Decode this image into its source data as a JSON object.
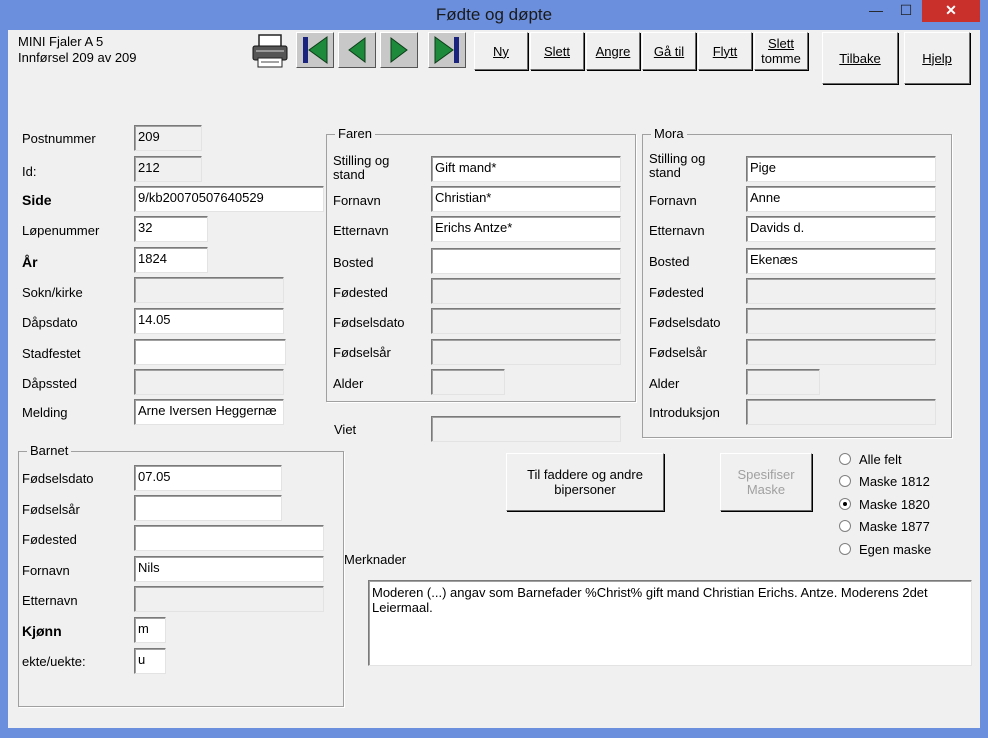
{
  "window": {
    "title": "Fødte og døpte",
    "minimize": "—",
    "maximize": "☐",
    "close": "✕"
  },
  "info": {
    "line1": "MINI Fjaler  A 5",
    "line2": "Innførsel 209 av 209"
  },
  "toolbar": {
    "new": "Ny",
    "delete": "Slett",
    "undo": "Angre",
    "goto": "Gå til",
    "move": "Flytt",
    "delete_empty_1": "Slett",
    "delete_empty_2": "tomme",
    "back": "Tilbake",
    "help": "Hjelp"
  },
  "left": {
    "postnummer_label": "Postnummer",
    "postnummer": "209",
    "id_label": "Id:",
    "id": "212",
    "side_label": "Side",
    "side": "9/kb20070507640529",
    "lopenummer_label": "Løpenummer",
    "lopenummer": "32",
    "ar_label": "År",
    "ar": "1824",
    "sokn_label": "Sokn/kirke",
    "sokn": "",
    "dapsdato_label": "Dåpsdato",
    "dapsdato": "14.05",
    "stadfestet_label": "Stadfestet",
    "stadfestet": "",
    "dapssted_label": "Dåpssted",
    "dapssted": "",
    "melding_label": "Melding",
    "melding": "Arne Iversen Heggernæ"
  },
  "barnet": {
    "legend": "Barnet",
    "fodselsdato_label": "Fødselsdato",
    "fodselsdato": "07.05",
    "fodselsar_label": "Fødselsår",
    "fodselsar": "",
    "fodested_label": "Fødested",
    "fodested": "",
    "fornavn_label": "Fornavn",
    "fornavn": "Nils",
    "etternavn_label": "Etternavn",
    "etternavn": "",
    "kjonn_label": "Kjønn",
    "kjonn": "m",
    "ekte_label": "ekte/uekte:",
    "ekte": "u"
  },
  "faren": {
    "legend": "Faren",
    "stilling_label_1": "Stilling og",
    "stilling_label_2": "stand",
    "stilling": "Gift mand*",
    "fornavn_label": "Fornavn",
    "fornavn": "Christian*",
    "etternavn_label": "Etternavn",
    "etternavn": "Erichs Antze*",
    "bosted_label": "Bosted",
    "bosted": "",
    "fodested_label": "Fødested",
    "fodested": "",
    "fodselsdato_label": "Fødselsdato",
    "fodselsdato": "",
    "fodselsar_label": "Fødselsår",
    "fodselsar": "",
    "alder_label": "Alder",
    "alder": ""
  },
  "viet": {
    "label": "Viet",
    "value": ""
  },
  "mora": {
    "legend": "Mora",
    "stilling_label_1": "Stilling og",
    "stilling_label_2": "stand",
    "stilling": "Pige",
    "fornavn_label": "Fornavn",
    "fornavn": "Anne",
    "etternavn_label": "Etternavn",
    "etternavn": "Davids d.",
    "bosted_label": "Bosted",
    "bosted": "Ekenæs",
    "fodested_label": "Fødested",
    "fodested": "",
    "fodselsdato_label": "Fødselsdato",
    "fodselsdato": "",
    "fodselsar_label": "Fødselsår",
    "fodselsar": "",
    "alder_label": "Alder",
    "alder": "",
    "introduksjon_label": "Introduksjon",
    "introduksjon": ""
  },
  "actions": {
    "faddere_1": "Til faddere og andre",
    "faddere_2": "bipersoner",
    "spesifiser_1": "Spesifiser",
    "spesifiser_2": "Maske"
  },
  "mask_options": [
    {
      "label": "Alle felt",
      "selected": false
    },
    {
      "label": "Maske 1812",
      "selected": false
    },
    {
      "label": "Maske 1820",
      "selected": true
    },
    {
      "label": "Maske 1877",
      "selected": false
    },
    {
      "label": "Egen maske",
      "selected": false
    }
  ],
  "merknader": {
    "label": "Merknader",
    "text": "Moderen (...) angav som Barnefader %Christ% gift mand Christian Erichs. Antze. Moderens 2det Leiermaal."
  },
  "icons": {
    "print": "printer-icon",
    "first": "first-record-icon",
    "prev": "prev-record-icon",
    "next": "next-record-icon",
    "last": "last-record-icon"
  },
  "colors": {
    "titlebar": "#6b8fdd",
    "close": "#c9302c",
    "nav_arrow": "#1c8a3a",
    "nav_bar": "#1a237e"
  }
}
